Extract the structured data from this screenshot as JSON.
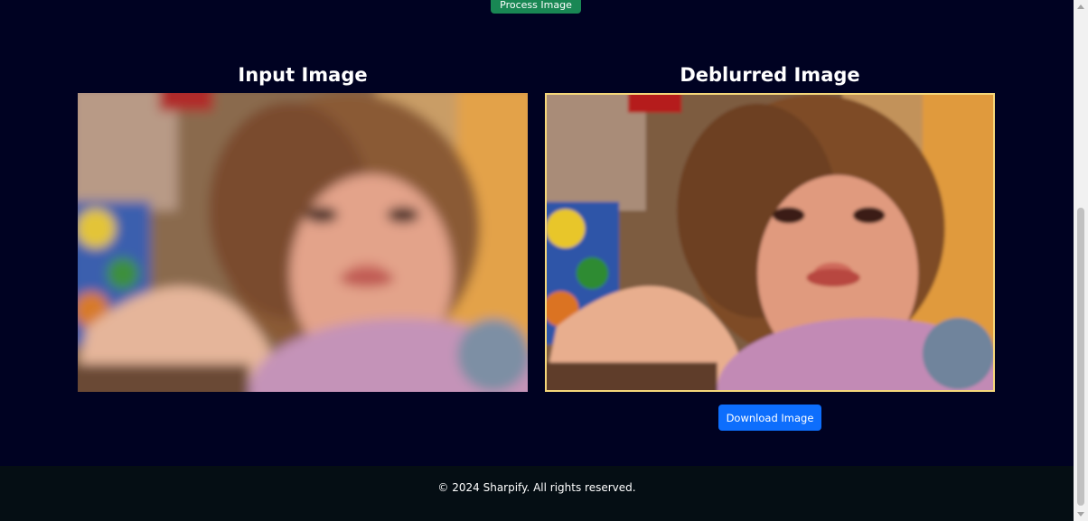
{
  "actions": {
    "process_label": "Process Image",
    "download_label": "Download Image"
  },
  "panels": {
    "input_title": "Input Image",
    "output_title": "Deblurred Image"
  },
  "footer": {
    "text": "© 2024 Sharpify. All rights reserved."
  },
  "colors": {
    "background": "#000222",
    "process_button": "#198754",
    "download_button": "#0d6efd",
    "footer_background": "#050e14",
    "output_border": "#f5d77a"
  }
}
